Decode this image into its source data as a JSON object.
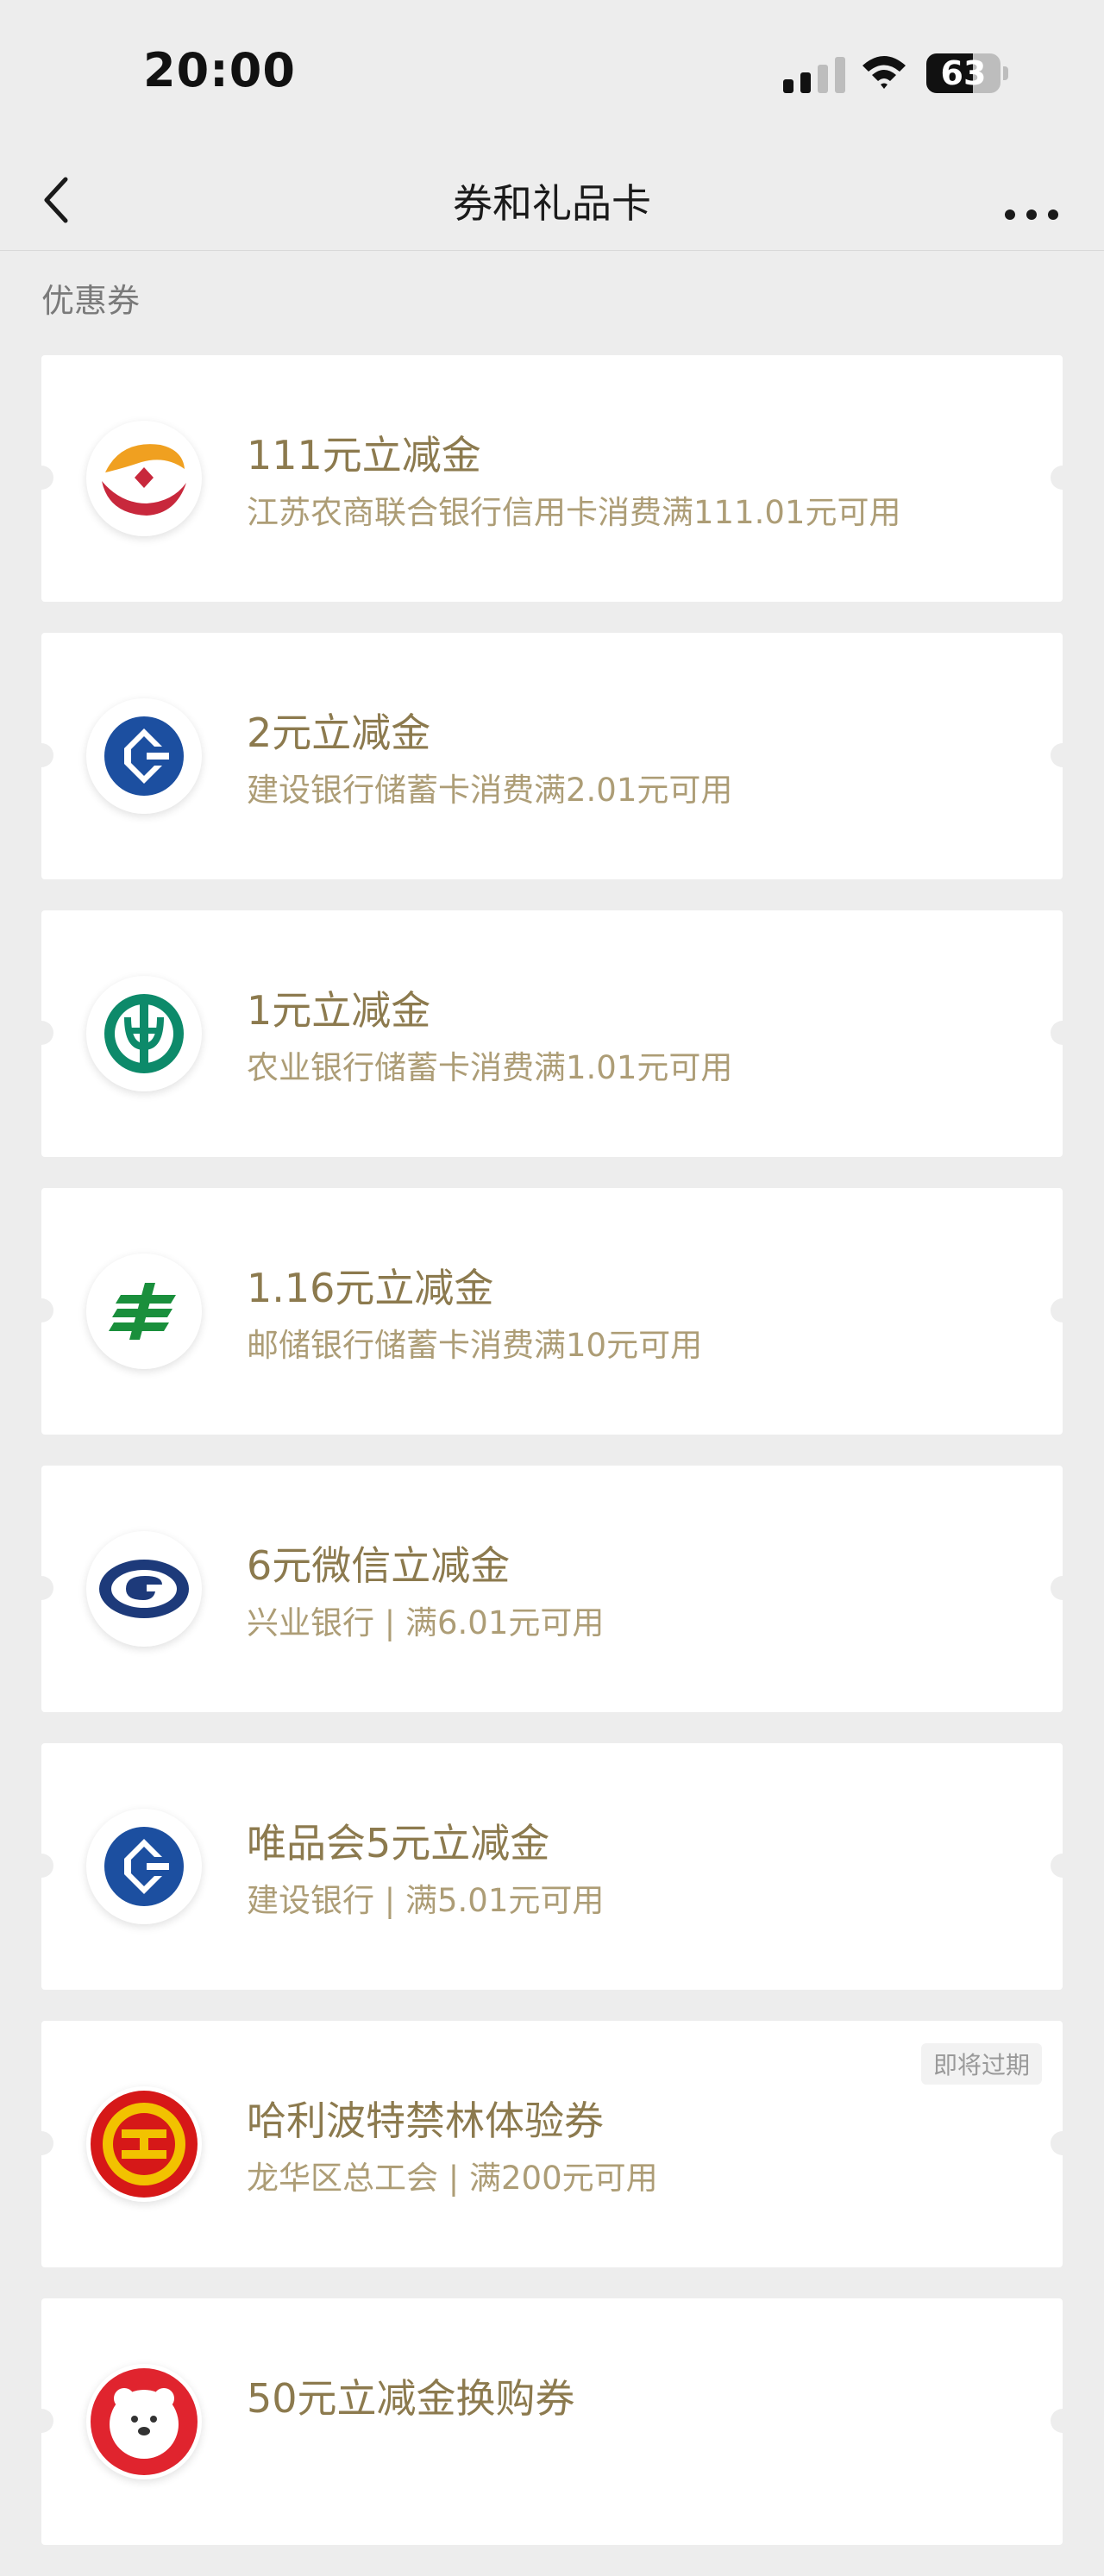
{
  "status_bar": {
    "time": "20:00",
    "battery": "63",
    "battery_level": 0.63
  },
  "nav": {
    "title": "券和礼品卡"
  },
  "section": {
    "title": "优惠券"
  },
  "coupons": [
    {
      "logo": "jiangsu-rural-bank-logo-icon",
      "title": "111元立减金",
      "desc": "江苏农商联合银行信用卡消费满111.01元可用",
      "badge": ""
    },
    {
      "logo": "ccb-bank-logo-icon",
      "title": "2元立减金",
      "desc": "建设银行储蓄卡消费满2.01元可用",
      "badge": ""
    },
    {
      "logo": "abc-bank-logo-icon",
      "title": "1元立减金",
      "desc": "农业银行储蓄卡消费满1.01元可用",
      "badge": ""
    },
    {
      "logo": "psbc-bank-logo-icon",
      "title": "1.16元立减金",
      "desc": "邮储银行储蓄卡消费满10元可用",
      "badge": ""
    },
    {
      "logo": "cib-bank-logo-icon",
      "title": "6元微信立减金",
      "desc": "兴业银行 | 满6.01元可用",
      "badge": ""
    },
    {
      "logo": "ccb-bank-logo-icon",
      "title": "唯品会5元立减金",
      "desc": "建设银行 | 满5.01元可用",
      "badge": ""
    },
    {
      "logo": "trade-union-logo-icon",
      "title": "哈利波特禁林体验券",
      "desc": "龙华区总工会 | 满200元可用",
      "badge": "即将过期"
    },
    {
      "logo": "polar-bear-logo-icon",
      "title": "50元立减金换购券",
      "desc": "",
      "badge": ""
    }
  ]
}
